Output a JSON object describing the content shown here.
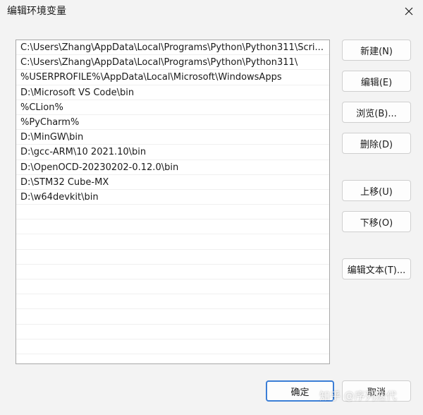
{
  "window": {
    "title": "编辑环境变量"
  },
  "paths": [
    "C:\\Users\\Zhang\\AppData\\Local\\Programs\\Python\\Python311\\Scri...",
    "C:\\Users\\Zhang\\AppData\\Local\\Programs\\Python\\Python311\\",
    "%USERPROFILE%\\AppData\\Local\\Microsoft\\WindowsApps",
    "D:\\Microsoft VS Code\\bin",
    "%CLion%",
    "%PyCharm%",
    "D:\\MinGW\\bin",
    "D:\\gcc-ARM\\10 2021.10\\bin",
    "D:\\OpenOCD-20230202-0.12.0\\bin",
    "D:\\STM32 Cube-MX",
    "D:\\w64devkit\\bin"
  ],
  "buttons": {
    "new": "新建(N)",
    "edit": "编辑(E)",
    "browse": "浏览(B)...",
    "delete": "删除(D)",
    "move_up": "上移(U)",
    "move_down": "下移(O)",
    "edit_text": "编辑文本(T)...",
    "ok": "确定",
    "cancel": "取消"
  },
  "watermark": "知乎 @序列迭代"
}
